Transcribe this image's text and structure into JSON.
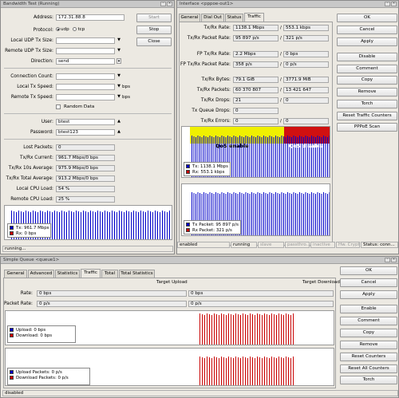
{
  "bandwidth": {
    "title": "Bandwidth Test (Running)",
    "address_label": "Address:",
    "address": "172.31.88.8",
    "protocol_label": "Protocol:",
    "udp": "udp",
    "tcp": "tcp",
    "local_udp_label": "Local UDP Tx Size:",
    "remote_udp_label": "Remote UDP Tx Size:",
    "direction_label": "Direction:",
    "direction": "send",
    "conn_label": "Connection Count:",
    "local_speed_label": "Local Tx Speed:",
    "remote_speed_label": "Remote Tx Speed:",
    "bps": "bps",
    "random_label": "Random Data",
    "user_label": "User:",
    "user": "btest",
    "password_label": "Password:",
    "password": "btest123",
    "lost_label": "Lost Packets:",
    "lost": "0",
    "current_label": "Tx/Rx Current:",
    "current": "961.7 Mbps/0 bps",
    "avg10_label": "Tx/Rx 10s Average:",
    "avg10": "975.9 Mbps/0 bps",
    "total_label": "Tx/Rx Total Average:",
    "total": "913.2 Mbps/0 bps",
    "local_cpu_label": "Local CPU Load:",
    "local_cpu": "54 %",
    "remote_cpu_label": "Remote CPU Load:",
    "remote_cpu": "25 %",
    "start": "Start",
    "stop": "Stop",
    "close": "Close",
    "legend_tx": "Tx:  961.7 Mbps",
    "legend_rx": "Rx:  0 bps",
    "status": "running..."
  },
  "interface": {
    "title": "Interface <pppoe-out1>",
    "tabs": [
      "General",
      "Dial Out",
      "Status",
      "Traffic"
    ],
    "rate_label": "Tx/Rx Rate:",
    "rate_tx": "1138.1 Mbps",
    "rate_rx": "553.1 kbps",
    "pkt_rate_label": "Tx/Rx Packet Rate:",
    "pkt_tx": "95 897 p/s",
    "pkt_rx": "321 p/s",
    "fp_rate_label": "FP Tx/Rx Rate:",
    "fp_tx": "2.2 Mbps",
    "fp_rx": "0 bps",
    "fp_pkt_label": "FP Tx/Rx Packet Rate:",
    "fp_pkt_tx": "358 p/s",
    "fp_pkt_rx": "0 p/s",
    "bytes_label": "Tx/Rx Bytes:",
    "bytes_tx": "79.1 GiB",
    "bytes_rx": "3771.9 MiB",
    "packets_label": "Tx/Rx Packets:",
    "packets_tx": "60 370 807",
    "packets_rx": "13 421 647",
    "drops_label": "Tx/Rx Drops:",
    "drops_tx": "21",
    "drops_rx": "0",
    "queue_label": "Tx Queue Drops:",
    "queue": "0",
    "errors_label": "Tx/Rx Errors:",
    "errors_tx": "0",
    "errors_rx": "0",
    "slash": "/",
    "qos_enable": "QoS enable",
    "qos_disable": "QoS disable",
    "legend_tx": "Tx:   1138.1 Mbps",
    "legend_rx": "Rx:   553.1 kbps",
    "legend_txp": "Tx Packet:  95 897 p/s",
    "legend_rxp": "Rx Packet:   321 p/s",
    "buttons": [
      "OK",
      "Cancel",
      "Apply",
      "Disable",
      "Comment",
      "Copy",
      "Remove",
      "Torch",
      "Reset Traffic Counters",
      "PPPoE Scan"
    ],
    "status": [
      "enabled",
      "running",
      "slave",
      "passthro...",
      "inactive",
      "Hw. Crypto",
      "Status: conn..."
    ]
  },
  "queue": {
    "title": "Simple Queue <queue1>",
    "tabs": [
      "General",
      "Advanced",
      "Statistics",
      "Traffic",
      "Total",
      "Total Statistics"
    ],
    "target_upload": "Target Upload",
    "target_download": "Target Download",
    "rate_label": "Rate:",
    "rate_up": "0 bps",
    "rate_down": "0 bps",
    "pkt_label": "Packet Rate:",
    "pkt_up": "0 p/s",
    "pkt_down": "0 p/s",
    "legend_up": "Upload:   0 bps",
    "legend_down": "Download:   0 bps",
    "legend_upp": "Upload Packets:   0 p/s",
    "legend_downp": "Download Packets:   0 p/s",
    "buttons": [
      "OK",
      "Cancel",
      "Apply",
      "Enable",
      "Comment",
      "Copy",
      "Remove",
      "Reset Counters",
      "Reset All Counters",
      "Torch"
    ],
    "status": "disabled"
  },
  "colors": {
    "tx": "#0000c8",
    "rx": "#c80000",
    "qos_enable": "#f0f000",
    "qos_disable": "#d01010"
  }
}
